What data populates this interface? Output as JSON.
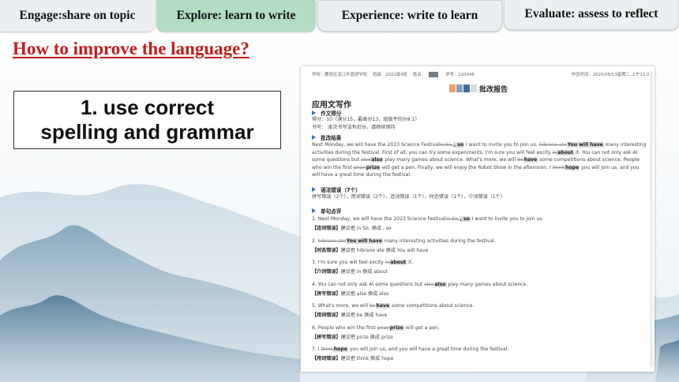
{
  "tabs": [
    {
      "label": "Engage:share on topic"
    },
    {
      "label": "Explore: learn to write"
    },
    {
      "label": "Experience: write to learn"
    },
    {
      "label": "Evaluate: assess to reflect"
    }
  ],
  "heading": "How to improve the language?",
  "callout": {
    "line1": "1. use correct",
    "line2": "spelling and grammar"
  },
  "report": {
    "meta": {
      "school": "学校：鹿邑区龙江外国语学校",
      "class": "班级：2022级9班",
      "name_label": "姓名：",
      "student_no": "学号：220946",
      "work_time": "作答时间：2025/05/13星期二  上午11:25"
    },
    "title": "批改报告",
    "section": "应用文写作",
    "score_header": "作文得分",
    "score_line": "得分：10（满分15，最高分13，班级平均分8.1）",
    "writing_line": "书写：  本次书写没有扣分，请继续保持",
    "result_header": "批改结果",
    "result": {
      "s1": "Next Monday, we will have the 2023 Science Festival",
      "d1": "in So,",
      "h1": ", so",
      "s2": " I want to invite you to join us. ",
      "d2": "hibrane ate",
      "h2": "You will have",
      "s3": " many interesting activities during the festival. First of all, you can try some experiments. I'm sure you will feel excity ",
      "d3": "in",
      "h3": "about",
      "s4": " it. You can not only ask AI some questions but ",
      "d4": "alse",
      "h4": "also",
      "s5": " play many games about science. What's more, we will ",
      "d5": "be",
      "h5": "have",
      "s6": " some competitions about science. People who win the first ",
      "d6": "pirze",
      "h6": "prize",
      "s7": " will get a pen. Finally, we will enjoy the Robot Show in the afternoon. I ",
      "d7": "think",
      "h7": "hope",
      "s8": " you will join us, and you will have a great time during the festival."
    },
    "errors_header": "语法错误（7个）",
    "errors_line": "拼写错误（2个），用词错误（2个），连词错误（1个），时态错误（1个），介词错误（1个）",
    "comments_header": "单句点评",
    "items": [
      {
        "n": "1. ",
        "a": "Next Monday, we will have the 2023 Science Festival",
        "d": "in So,",
        "h": ", so",
        "b": " I want to invite you to join us.",
        "tag": "【连词错误】",
        "sug": "建议把 in So, 换成 , so"
      },
      {
        "n": "2. ",
        "a": "",
        "d": "hibrane ate",
        "h": "You will have",
        "b": " many interesting activities during the festival.",
        "tag": "【时态错误】",
        "sug": "建议把 hibrane ate 换成 You will have"
      },
      {
        "n": "3. ",
        "a": "I'm sure you will feel excity ",
        "d": "in",
        "h": "about",
        "b": " it.",
        "tag": "【介词错误】",
        "sug": "建议把 in 换成 about"
      },
      {
        "n": "4. ",
        "a": "You can not only ask AI some questions but ",
        "d": "alse",
        "h": "also",
        "b": " play many games about science.",
        "tag": "【拼写错误】",
        "sug": "建议把 alse 换成 also"
      },
      {
        "n": "5. ",
        "a": "What's more, we will ",
        "d": "be",
        "h": "have",
        "b": " some competitions about science.",
        "tag": "【用词错误】",
        "sug": "建议把 be 换成 have"
      },
      {
        "n": "6. ",
        "a": "People who win the first ",
        "d": "pirze",
        "h": "prize",
        "b": " will get a pen.",
        "tag": "【拼写错误】",
        "sug": "建议把 pirze 换成 prize"
      },
      {
        "n": "7. ",
        "a": "I ",
        "d": "think",
        "h": "hope",
        "b": " you will join us, and you will have a great time during the festival.",
        "tag": "【用词错误】",
        "sug": "建议把 think 换成 hope"
      }
    ]
  },
  "colors": {
    "accent_red": "#c21d1d",
    "active_tab": "#b4dcc3",
    "tab_bg": "#eceff1",
    "report_blue": "#3a6cc8"
  }
}
